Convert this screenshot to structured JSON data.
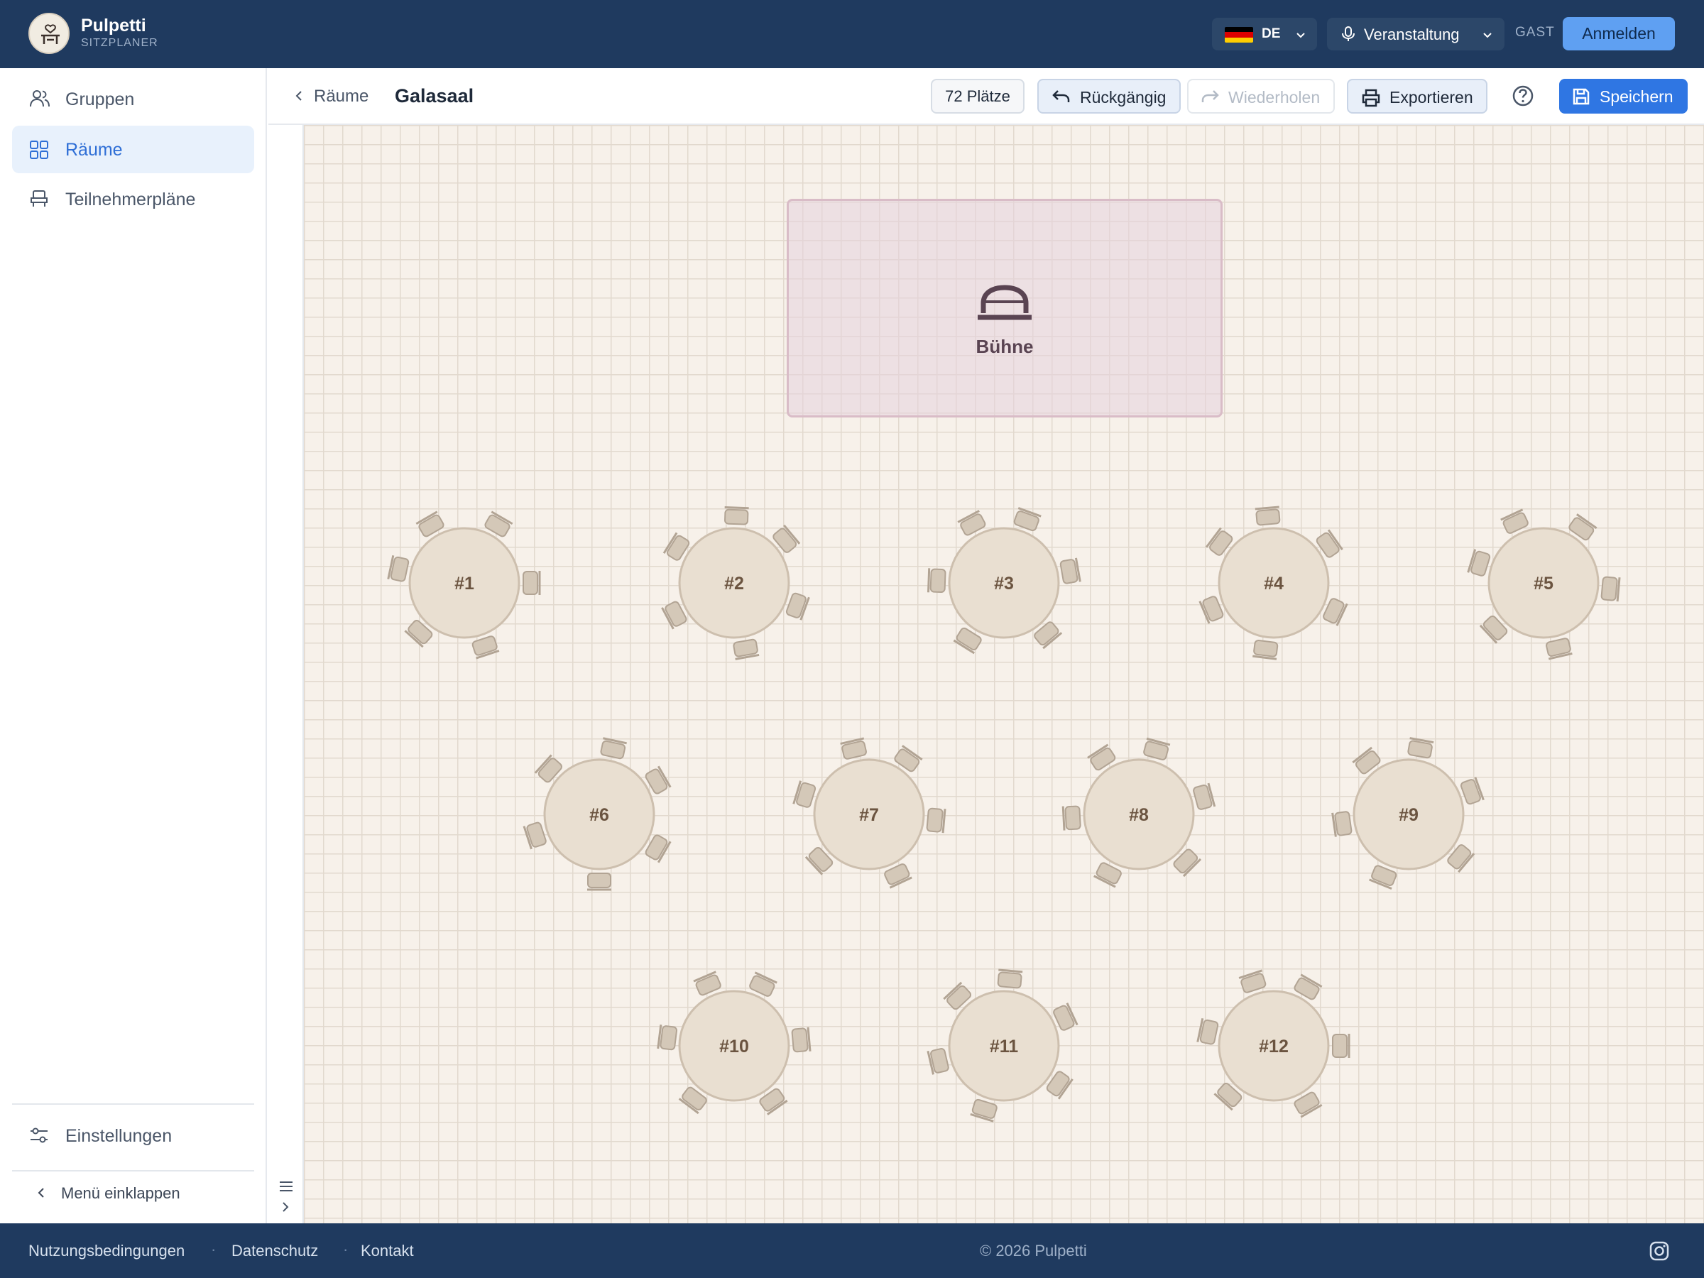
{
  "header": {
    "brand_name": "Pulpetti",
    "brand_sub": "SITZPLANER",
    "language": "DE",
    "event_label": "Veranstaltung",
    "guest_label": "GAST",
    "login_label": "Anmelden"
  },
  "sidebar": {
    "items": [
      {
        "label": "Gruppen",
        "icon": "users-icon",
        "active": false
      },
      {
        "label": "Räume",
        "icon": "grid-icon",
        "active": true
      },
      {
        "label": "Teilnehmerpläne",
        "icon": "seat-icon",
        "active": false
      }
    ],
    "settings_label": "Einstellungen",
    "collapse_label": "Menü einklappen"
  },
  "toolbar": {
    "back_label": "Räume",
    "room_title": "Galasaal",
    "seats_count": "72 Plätze",
    "undo_label": "Rückgängig",
    "redo_label": "Wiederholen",
    "export_label": "Exportieren",
    "save_label": "Speichern"
  },
  "canvas": {
    "stage_label": "Bühne",
    "tables": [
      {
        "label": "#1",
        "seats": 6
      },
      {
        "label": "#2",
        "seats": 6
      },
      {
        "label": "#3",
        "seats": 6
      },
      {
        "label": "#4",
        "seats": 6
      },
      {
        "label": "#5",
        "seats": 6
      },
      {
        "label": "#6",
        "seats": 6
      },
      {
        "label": "#7",
        "seats": 6
      },
      {
        "label": "#8",
        "seats": 6
      },
      {
        "label": "#9",
        "seats": 6
      },
      {
        "label": "#10",
        "seats": 6
      },
      {
        "label": "#11",
        "seats": 6
      },
      {
        "label": "#12",
        "seats": 6
      }
    ],
    "colors": {
      "table_fill": "#e9dfd1",
      "table_stroke": "#cdbfae",
      "chair_fill": "#d4c8b8",
      "chair_stroke": "#b2a494"
    }
  },
  "footer": {
    "links": [
      "Nutzungsbedingungen",
      "Datenschutz",
      "Kontakt"
    ],
    "copyright": "© 2026 Pulpetti"
  }
}
